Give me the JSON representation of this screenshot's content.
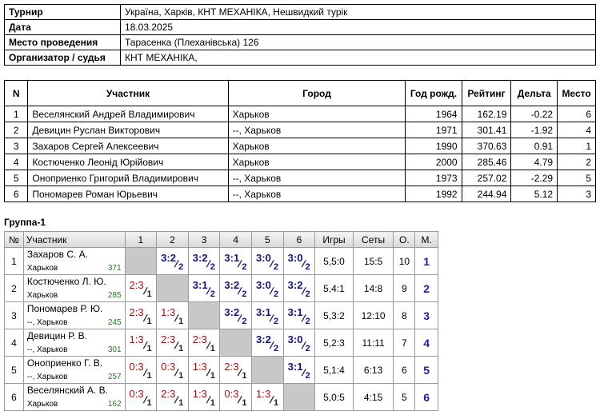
{
  "info": [
    {
      "label": "Турнир",
      "value": "Україна, Харків, КНТ МЕХАНІКА, Нешвидкий турік"
    },
    {
      "label": "Дата",
      "value": "18.03.2025"
    },
    {
      "label": "Место проведения",
      "value": "Тарасенка (Плеханівська) 126"
    },
    {
      "label": "Организатор / судья",
      "value": "КНТ МЕХАНІКА,"
    }
  ],
  "participants": {
    "headers": [
      "N",
      "Участник",
      "Город",
      "Год рожд.",
      "Рейтинг",
      "Дельта",
      "Место"
    ],
    "rows": [
      [
        "1",
        "Веселянский Андрей Владимирович",
        "Харьков",
        "1964",
        "162.19",
        "-0.22",
        "6"
      ],
      [
        "2",
        "Девицин Руслан Викторович",
        "--, Харьков",
        "1971",
        "301.41",
        "-1.92",
        "4"
      ],
      [
        "3",
        "Захаров Сергей Алексеевич",
        "Харьков",
        "1990",
        "370.63",
        "0.91",
        "1"
      ],
      [
        "4",
        "Костюченко Леонід Юрійович",
        "Харьков",
        "2000",
        "285.46",
        "4.79",
        "2"
      ],
      [
        "5",
        "Оноприенко Григорий Владимирович",
        "--, Харьков",
        "1973",
        "257.02",
        "-2.29",
        "5"
      ],
      [
        "6",
        "Пономарев Роман Юрьевич",
        "--, Харьков",
        "1992",
        "244.94",
        "5.12",
        "3"
      ]
    ]
  },
  "group": {
    "title": "Группа-1",
    "headers": [
      "№",
      "Участник",
      "1",
      "2",
      "3",
      "4",
      "5",
      "6",
      "Игры",
      "Сеты",
      "О.",
      "М."
    ],
    "rows": [
      {
        "n": "1",
        "name": "Захаров С. А.",
        "city": "Харьков",
        "rating": "371",
        "results": [
          null,
          [
            "3:2",
            "2"
          ],
          [
            "3:2",
            "2"
          ],
          [
            "3:1",
            "2"
          ],
          [
            "3:0",
            "2"
          ],
          [
            "3:0",
            "2"
          ]
        ],
        "games": "5,5:0",
        "sets": "15:5",
        "points": "10",
        "place": "1"
      },
      {
        "n": "2",
        "name": "Костюченко Л. Ю.",
        "city": "Харьков",
        "rating": "285",
        "results": [
          [
            "2:3",
            "1"
          ],
          null,
          [
            "3:1",
            "2"
          ],
          [
            "3:2",
            "2"
          ],
          [
            "3:0",
            "2"
          ],
          [
            "3:2",
            "2"
          ]
        ],
        "games": "5,4:1",
        "sets": "14:8",
        "points": "9",
        "place": "2"
      },
      {
        "n": "3",
        "name": "Пономарев Р. Ю.",
        "city": "--, Харьков",
        "rating": "245",
        "results": [
          [
            "2:3",
            "1"
          ],
          [
            "1:3",
            "1"
          ],
          null,
          [
            "3:2",
            "2"
          ],
          [
            "3:1",
            "2"
          ],
          [
            "3:1",
            "2"
          ]
        ],
        "games": "5,3:2",
        "sets": "12:10",
        "points": "8",
        "place": "3"
      },
      {
        "n": "4",
        "name": "Девицин Р. В.",
        "city": "--, Харьков",
        "rating": "301",
        "results": [
          [
            "1:3",
            "1"
          ],
          [
            "2:3",
            "1"
          ],
          [
            "2:3",
            "1"
          ],
          null,
          [
            "3:2",
            "2"
          ],
          [
            "3:0",
            "2"
          ]
        ],
        "games": "5,2:3",
        "sets": "11:11",
        "points": "7",
        "place": "4"
      },
      {
        "n": "5",
        "name": "Оноприенко Г. В.",
        "city": "--, Харьков",
        "rating": "257",
        "results": [
          [
            "0:3",
            "1"
          ],
          [
            "0:3",
            "1"
          ],
          [
            "1:3",
            "1"
          ],
          [
            "2:3",
            "1"
          ],
          null,
          [
            "3:1",
            "2"
          ]
        ],
        "games": "5,1:4",
        "sets": "6:13",
        "points": "6",
        "place": "5"
      },
      {
        "n": "6",
        "name": "Веселянский А. В.",
        "city": "Харьков",
        "rating": "162",
        "results": [
          [
            "0:3",
            "1"
          ],
          [
            "2:3",
            "1"
          ],
          [
            "1:3",
            "1"
          ],
          [
            "0:3",
            "1"
          ],
          [
            "1:3",
            "1"
          ],
          null
        ],
        "games": "5,0:5",
        "sets": "4:15",
        "points": "5",
        "place": "6"
      }
    ]
  }
}
